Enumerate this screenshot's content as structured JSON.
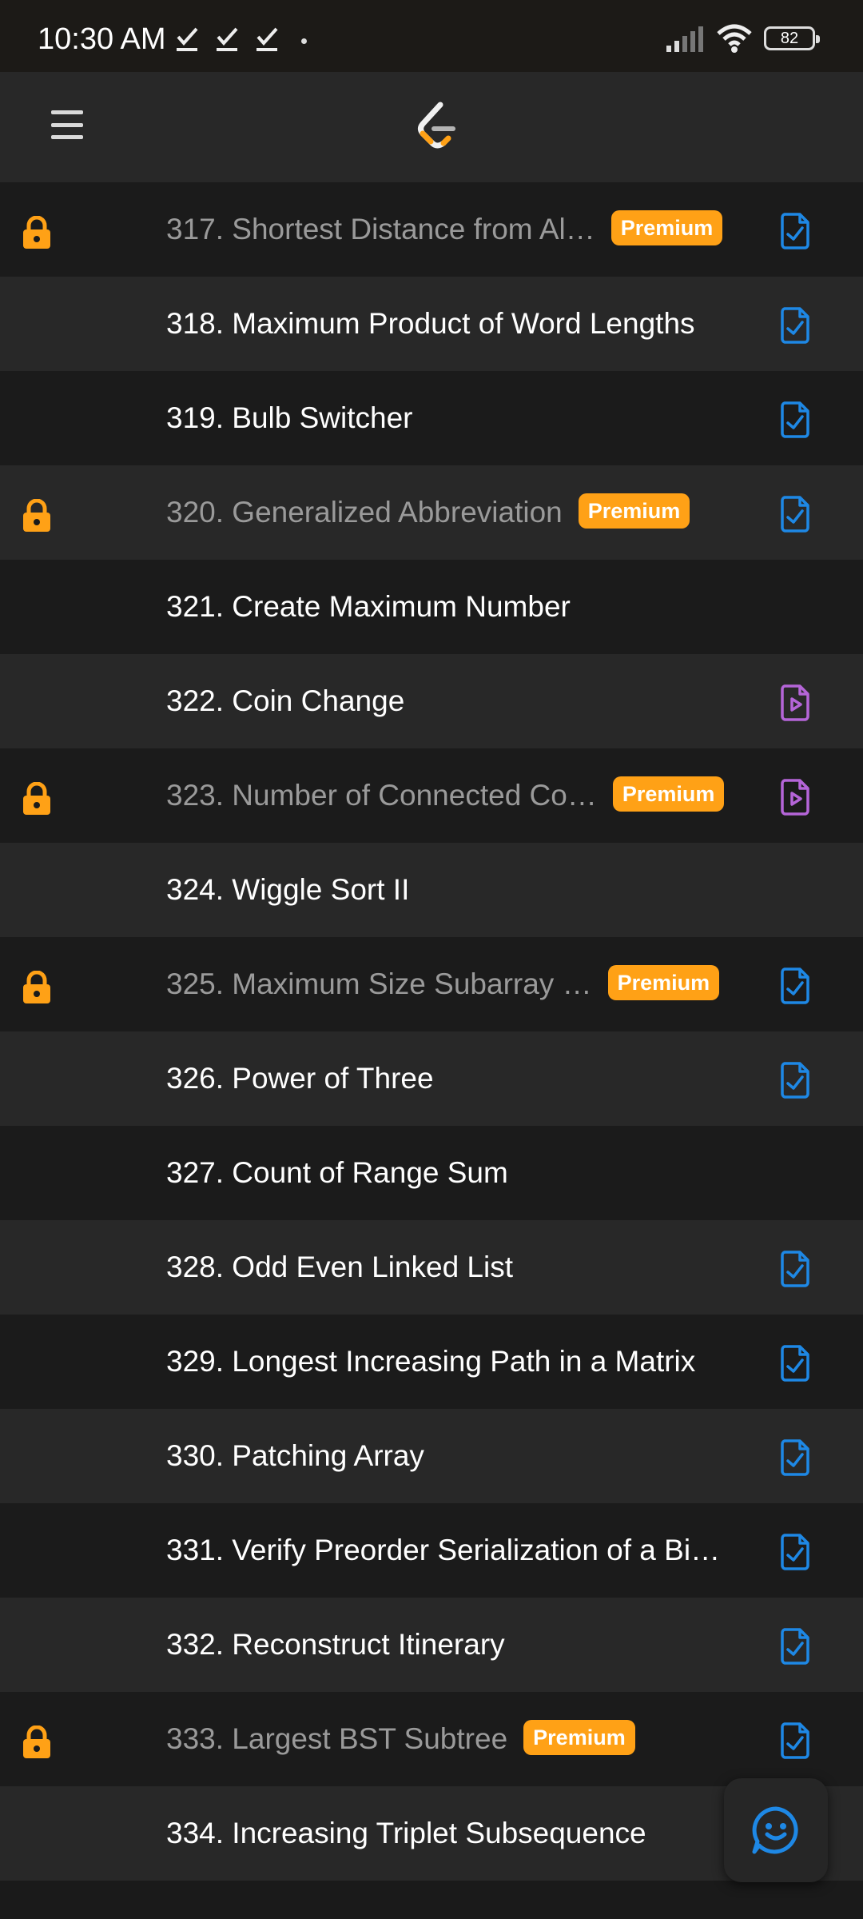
{
  "status_bar": {
    "time": "10:30 AM",
    "battery": "82"
  },
  "problems": [
    {
      "title": "317. Shortest Distance from Al…",
      "locked": true,
      "premium": "Premium",
      "solution": "check",
      "shade": "dark"
    },
    {
      "title": "318. Maximum Product of Word Lengths",
      "locked": false,
      "premium": "",
      "solution": "check",
      "shade": "light"
    },
    {
      "title": "319. Bulb Switcher",
      "locked": false,
      "premium": "",
      "solution": "check",
      "shade": "dark"
    },
    {
      "title": "320. Generalized Abbreviation",
      "locked": true,
      "premium": "Premium",
      "solution": "check",
      "shade": "light"
    },
    {
      "title": "321. Create Maximum Number",
      "locked": false,
      "premium": "",
      "solution": "none",
      "shade": "dark"
    },
    {
      "title": "322. Coin Change",
      "locked": false,
      "premium": "",
      "solution": "video",
      "shade": "light"
    },
    {
      "title": "323. Number of Connected Co…",
      "locked": true,
      "premium": "Premium",
      "solution": "video",
      "shade": "dark"
    },
    {
      "title": "324. Wiggle Sort II",
      "locked": false,
      "premium": "",
      "solution": "none",
      "shade": "light"
    },
    {
      "title": "325. Maximum Size Subarray …",
      "locked": true,
      "premium": "Premium",
      "solution": "check",
      "shade": "dark"
    },
    {
      "title": "326. Power of Three",
      "locked": false,
      "premium": "",
      "solution": "check",
      "shade": "light"
    },
    {
      "title": "327. Count of Range Sum",
      "locked": false,
      "premium": "",
      "solution": "none",
      "shade": "dark"
    },
    {
      "title": "328. Odd Even Linked List",
      "locked": false,
      "premium": "",
      "solution": "check",
      "shade": "light"
    },
    {
      "title": "329. Longest Increasing Path in a Matrix",
      "locked": false,
      "premium": "",
      "solution": "check",
      "shade": "dark"
    },
    {
      "title": "330. Patching Array",
      "locked": false,
      "premium": "",
      "solution": "check",
      "shade": "light"
    },
    {
      "title": "331. Verify Preorder Serialization of a Bi…",
      "locked": false,
      "premium": "",
      "solution": "check",
      "shade": "dark"
    },
    {
      "title": "332. Reconstruct Itinerary",
      "locked": false,
      "premium": "",
      "solution": "check",
      "shade": "light"
    },
    {
      "title": "333. Largest BST Subtree",
      "locked": true,
      "premium": "Premium",
      "solution": "check",
      "shade": "dark"
    },
    {
      "title": "334. Increasing Triplet Subsequence",
      "locked": false,
      "premium": "",
      "solution": "none",
      "shade": "light"
    }
  ],
  "icons": {
    "lock": "lock-icon",
    "solution_check": "solution-article-icon",
    "solution_video": "video-solution-icon",
    "menu": "hamburger-menu-icon",
    "logo": "leetcode-logo",
    "feedback": "feedback-smiley-icon"
  },
  "colors": {
    "premium": "#ffa116",
    "lock": "#ffa116",
    "solution_check": "#1e88e5",
    "solution_video": "#b565d8"
  }
}
